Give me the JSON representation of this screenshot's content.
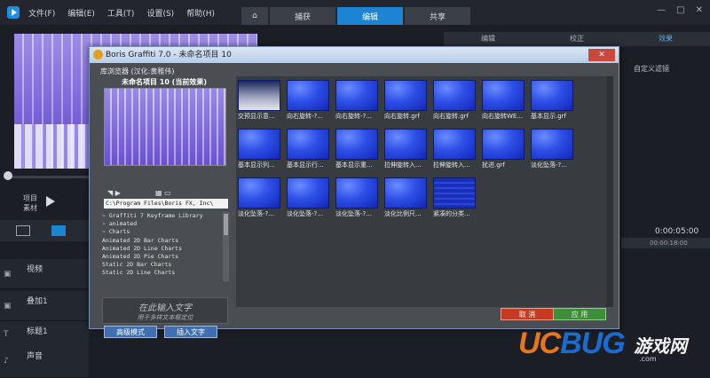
{
  "host": {
    "menu": [
      "文件(F)",
      "编辑(E)",
      "工具(T)",
      "设置(S)",
      "帮助(H)"
    ],
    "tabs": [
      {
        "label": ""
      },
      {
        "label": "捕获"
      },
      {
        "label": "编辑"
      },
      {
        "label": "共享"
      }
    ],
    "active_tab": "编辑",
    "win_controls": [
      "—",
      "□",
      "✕"
    ],
    "right_tabs": [
      "编辑",
      "校正",
      "效果"
    ],
    "custom_label": "自定义滤镜",
    "transport": {
      "project": "项目",
      "clip": "素材"
    },
    "timecode": "0:00:05:00",
    "ruler_tick": "00:00:18:00",
    "tracks": [
      {
        "label": "视频"
      },
      {
        "label": "叠加1"
      },
      {
        "label": "标题1"
      },
      {
        "label": "声音"
      }
    ]
  },
  "dialog": {
    "title": "Boris Graffiti 7.0 - 未命名项目 10",
    "close": "✕",
    "library_title": "库浏览器 (汉化:黄稚伟)",
    "project_title": "未命名项目 10 (当前效果)",
    "path": "C:\\Program Files\\Boris FX, Inc\\",
    "tree": [
      "~ Graffiti 7 Keyframe Library",
      "› animated",
      "~ Charts",
      "   Animated 2D Bar Charts",
      "   Animated 2D Line Charts",
      "   Animated 2D Pie Charts",
      "   Static 2D Bar Charts",
      "   Static 2D Line Charts"
    ],
    "text_input_big": "在此输入文字",
    "text_input_small": "用于多样文本框定位",
    "advanced_button": "高级模式",
    "insert_text_button": "插入文字",
    "cancel_button": "取 消",
    "apply_button": "应 用",
    "thumbnails": [
      "交预显示意...",
      "向右旋转-?...",
      "向右旋转-?...",
      "向右旋转.grf",
      "向右旋转.grf",
      "向右旋转WE...",
      "基本显示.grf",
      "基本显示列...",
      "基本显示行...",
      "基本显示重...",
      "拉伸旋转入...",
      "拉伸旋转入...",
      "扰进.grf",
      "淡化坠落-?...",
      "淡化坠落-?...",
      "淡化坠落-?...",
      "淡化坠落-?...",
      "淡化比例尺...",
      "紧凑的分类..."
    ]
  },
  "watermark": {
    "uc": "UC",
    "bug": "BUG",
    "cn": "游戏网",
    "url": ".com"
  }
}
